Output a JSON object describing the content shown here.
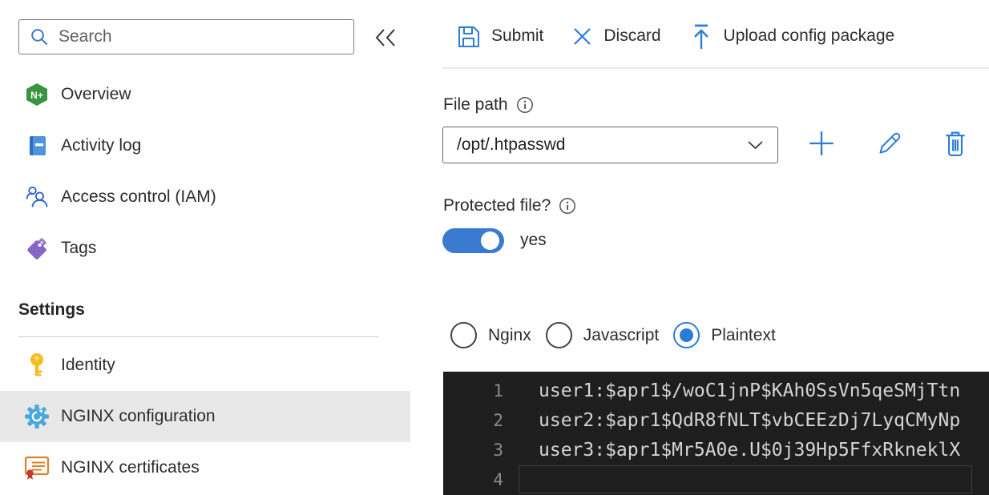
{
  "colors": {
    "accent": "#0078d4",
    "icon_blue": "#2b7cd9",
    "toggle_on": "#3b7ad1",
    "selected_row_bg": "#e8e8e8",
    "editor_bg": "#1e1e1e",
    "editor_text": "#d4d4d4",
    "line_number_gray": "#8a8a8a"
  },
  "sidebar": {
    "search": {
      "placeholder": "Search",
      "icon": "search-icon"
    },
    "collapse_icon": "chevrons-left-icon",
    "menu_items": [
      {
        "label": "Overview",
        "icon": "nginx-plus-icon"
      },
      {
        "label": "Activity log",
        "icon": "activity-log-icon"
      },
      {
        "label": "Access control (IAM)",
        "icon": "access-control-icon"
      },
      {
        "label": "Tags",
        "icon": "tags-icon"
      }
    ],
    "settings": {
      "heading": "Settings",
      "items": [
        {
          "label": "Identity",
          "icon": "key-icon",
          "selected": false
        },
        {
          "label": "NGINX configuration",
          "icon": "gear-sync-icon",
          "selected": true
        },
        {
          "label": "NGINX certificates",
          "icon": "certificate-icon",
          "selected": false
        }
      ]
    }
  },
  "toolbar": {
    "buttons": [
      {
        "label": "Submit",
        "icon": "save-icon"
      },
      {
        "label": "Discard",
        "icon": "close-x-icon"
      },
      {
        "label": "Upload config package",
        "icon": "upload-icon"
      }
    ]
  },
  "main": {
    "file_path": {
      "label": "File path",
      "info_icon": "info-icon",
      "value": "/opt/.htpasswd",
      "actions": [
        "add-icon",
        "edit-icon",
        "delete-icon"
      ]
    },
    "protected_file": {
      "label": "Protected file?",
      "info_icon": "info-icon",
      "state": "on",
      "state_label": "yes"
    },
    "format_options": [
      {
        "label": "Nginx",
        "selected": false
      },
      {
        "label": "Javascript",
        "selected": false
      },
      {
        "label": "Plaintext",
        "selected": true
      }
    ],
    "editor": {
      "lines": [
        {
          "number": "1",
          "text": "user1:$apr1$/woC1jnP$KAh0SsVn5qeSMjTtn"
        },
        {
          "number": "2",
          "text": "user2:$apr1$QdR8fNLT$vbCEEzDj7LyqCMyNp"
        },
        {
          "number": "3",
          "text": "user3:$apr1$Mr5A0e.U$0j39Hp5FfxRkneklX"
        },
        {
          "number": "4",
          "text": "",
          "current_line": true
        }
      ]
    }
  }
}
